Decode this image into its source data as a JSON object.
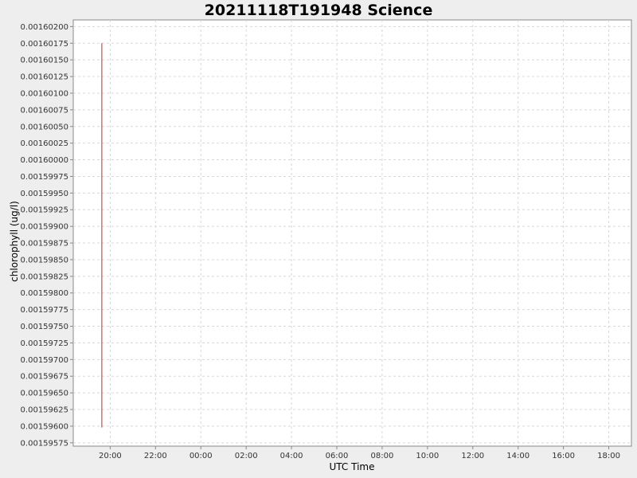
{
  "chart_data": {
    "type": "line",
    "title": "20211118T191948 Science",
    "xlabel": "UTC Time",
    "ylabel": "chlorophyll (ug/l)",
    "x_ticks": [
      "20:00",
      "22:00",
      "00:00",
      "02:00",
      "04:00",
      "06:00",
      "08:00",
      "10:00",
      "12:00",
      "14:00",
      "16:00",
      "18:00"
    ],
    "x_tick_hours": [
      20,
      22,
      24,
      26,
      28,
      30,
      32,
      34,
      36,
      38,
      40,
      42
    ],
    "xlim_hours": [
      18.37,
      43.0
    ],
    "y_ticks": [
      "0.00160200",
      "0.00160175",
      "0.00160150",
      "0.00160125",
      "0.00160100",
      "0.00160075",
      "0.00160050",
      "0.00160025",
      "0.00160000",
      "0.00159975",
      "0.00159950",
      "0.00159925",
      "0.00159900",
      "0.00159875",
      "0.00159850",
      "0.00159825",
      "0.00159800",
      "0.00159775",
      "0.00159750",
      "0.00159725",
      "0.00159700",
      "0.00159675",
      "0.00159650",
      "0.00159625",
      "0.00159600",
      "0.00159575"
    ],
    "ylim": [
      0.0015957,
      0.0016021
    ],
    "grid": true,
    "series": [
      {
        "color": "#b03030",
        "x_hours": [
          19.63,
          19.63
        ],
        "y": [
          0.00159598,
          0.00160175
        ]
      }
    ]
  }
}
